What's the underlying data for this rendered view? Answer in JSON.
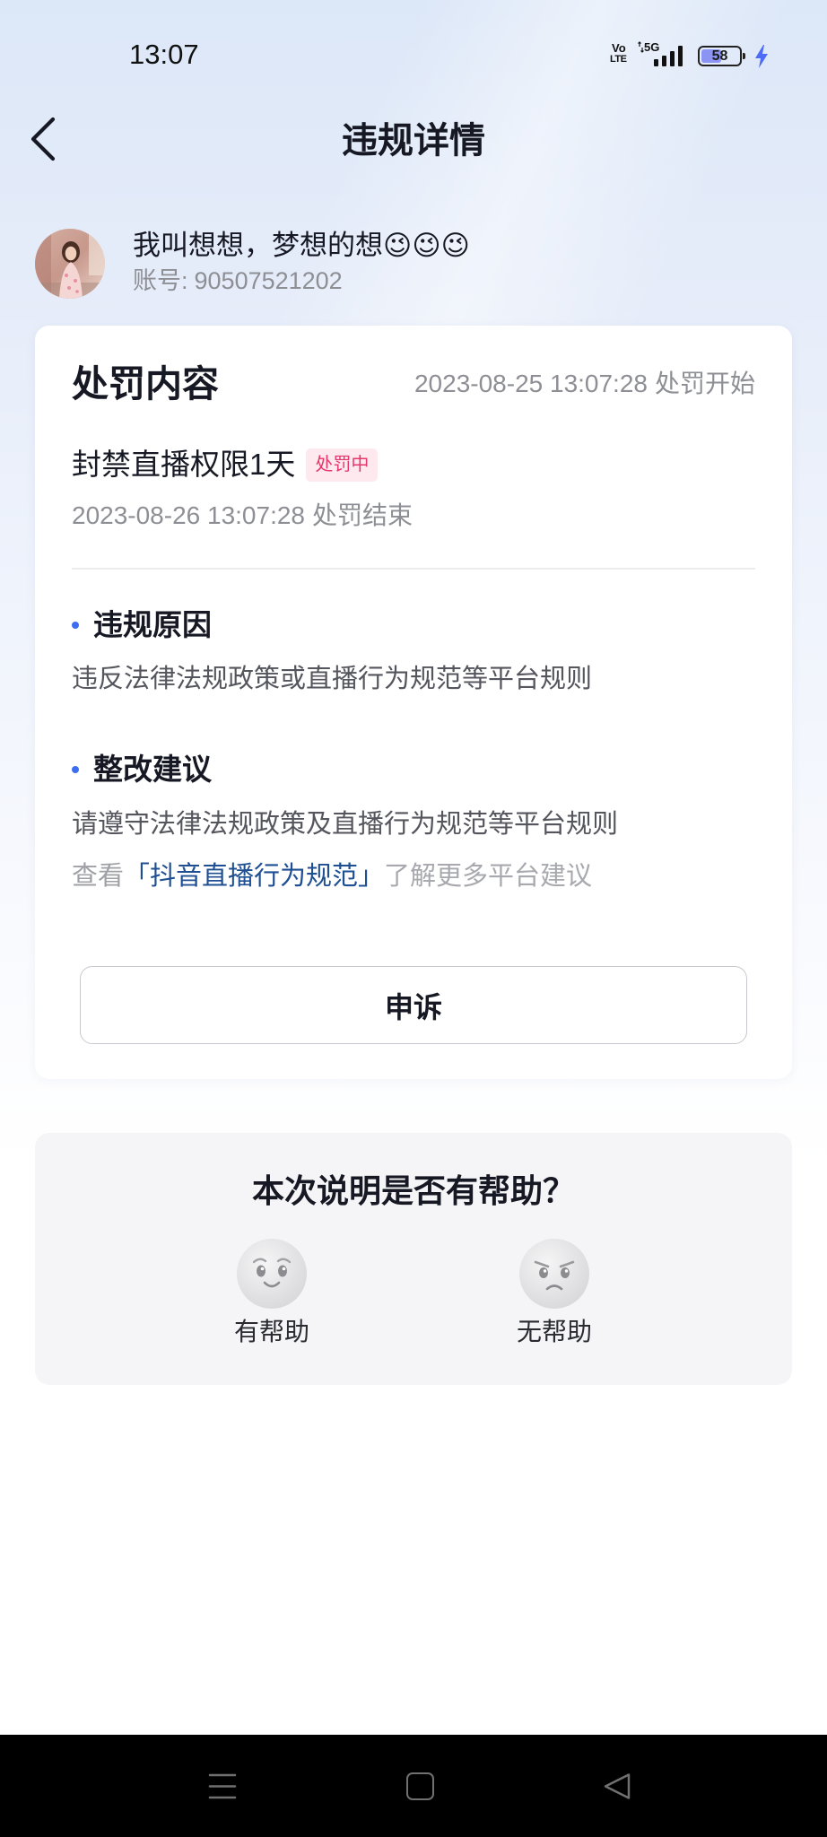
{
  "status_bar": {
    "time": "13:07",
    "volte_top": "Vo",
    "volte_bottom": "LTE",
    "network": "5G",
    "battery_level": "58",
    "icons": {
      "volte": "volte-icon",
      "signal": "signal-icon",
      "battery": "battery-icon",
      "charging": "charging-icon"
    }
  },
  "header": {
    "back_icon": "chevron-left-icon",
    "title": "违规详情"
  },
  "profile": {
    "name": "我叫想想，梦想的想😉😉😉",
    "account_label": "账号:",
    "account_id": "90507521202"
  },
  "penalty": {
    "heading": "处罚内容",
    "start_time": "2023-08-25 13:07:28",
    "start_label": "处罚开始",
    "title": "封禁直播权限1天",
    "status_badge": "处罚中",
    "end_time": "2023-08-26 13:07:28",
    "end_label": "处罚结束",
    "sections": [
      {
        "heading": "违规原因",
        "text": "违反法律法规政策或直播行为规范等平台规则"
      },
      {
        "heading": "整改建议",
        "text": "请遵守法律法规政策及直播行为规范等平台规则"
      }
    ],
    "guideline_link": {
      "prefix": "查看",
      "link": "「抖音直播行为规范」",
      "suffix": "了解更多平台建议"
    },
    "appeal_button": "申诉"
  },
  "feedback": {
    "question": "本次说明是否有帮助？",
    "options": [
      {
        "label": "有帮助",
        "icon": "smiling-face-icon"
      },
      {
        "label": "无帮助",
        "icon": "frowning-face-icon"
      }
    ]
  },
  "nav_bar": {
    "icons": [
      "menu-icon",
      "home-square-icon",
      "back-triangle-icon"
    ]
  },
  "colors": {
    "accent_blue": "#3d6ef0",
    "link_blue": "#1f4f93",
    "badge_bg": "#fde9ee",
    "badge_text": "#e6366c",
    "charging": "#4d6bf6",
    "battery_fill": "#8b93f3"
  }
}
